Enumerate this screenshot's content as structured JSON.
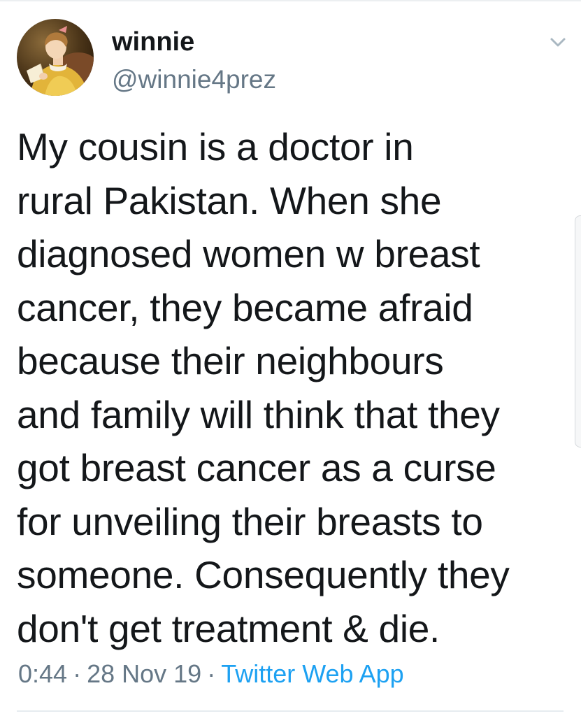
{
  "author": {
    "display_name": "winnie",
    "handle": "@winnie4prez",
    "avatar_icon": "profile-portrait-avatar"
  },
  "tweet": {
    "text": "My cousin is a doctor in\nrural Pakistan. When she\ndiagnosed women w breast\ncancer, they became afraid\nbecause their neighbours\nand family will think that they\ngot breast cancer as a curse\nfor unveiling their breasts to\nsomeone. Consequently they\ndon't get treatment & die."
  },
  "meta": {
    "time": "0:44",
    "separator": "·",
    "date": "28 Nov 19",
    "source": "Twitter Web App"
  },
  "icons": {
    "menu": "chevron-down-icon"
  },
  "colors": {
    "text": "#14171a",
    "secondary": "#657786",
    "link": "#1da1f2"
  }
}
